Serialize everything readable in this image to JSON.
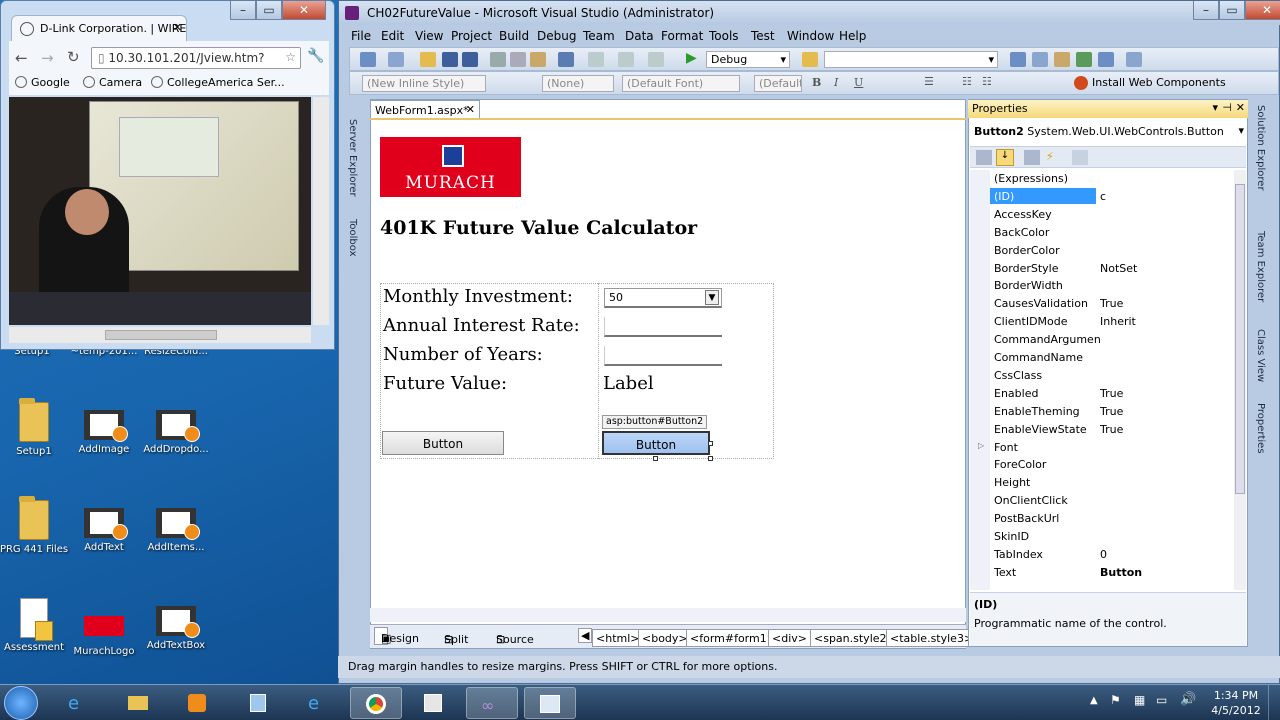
{
  "desktop": {
    "icons": [
      {
        "label": "Setup1",
        "type": "folder"
      },
      {
        "label": "~temp-201...",
        "type": "film"
      },
      {
        "label": "ResizeColu...",
        "type": "film"
      },
      {
        "label": "Setup1",
        "type": "folder"
      },
      {
        "label": "AddImage",
        "type": "film"
      },
      {
        "label": "AddDropdo...",
        "type": "film"
      },
      {
        "label": "PRG 441 Files",
        "type": "folder"
      },
      {
        "label": "AddText",
        "type": "film"
      },
      {
        "label": "AddItems...",
        "type": "film"
      },
      {
        "label": "Assessment",
        "type": "doc"
      },
      {
        "label": "MurachLogo",
        "type": "image"
      },
      {
        "label": "AddTextBox",
        "type": "film"
      }
    ]
  },
  "browser": {
    "tab_title": "D-Link Corporation. | WIREL",
    "url": "10.30.101.201/Jview.htm?",
    "bookmarks": [
      "Google",
      "Camera",
      "CollegeAmerica Ser..."
    ]
  },
  "vs": {
    "title": "CH02FutureValue - Microsoft Visual Studio (Administrator)",
    "menu": [
      "File",
      "Edit",
      "View",
      "Project",
      "Build",
      "Debug",
      "Team",
      "Data",
      "Format",
      "Tools",
      "Test",
      "Window",
      "Help"
    ],
    "config": "Debug",
    "install_label": "Install Web Components",
    "style_boxes": [
      "(New Inline Style)",
      "(None)",
      "(Default Font)",
      "(Default"
    ],
    "left_tabs": [
      "Server Explorer",
      "Toolbox"
    ],
    "right_tabs": [
      "Solution Explorer",
      "Team Explorer",
      "Class View",
      "Properties"
    ],
    "doc_tab": "WebForm1.aspx*",
    "designer": {
      "logo": "MURACH",
      "heading": "401K Future Value Calculator",
      "labels": [
        "Monthly Investment:",
        "Annual Interest Rate:",
        "Number of Years:",
        "Future Value:"
      ],
      "dropdown_value": "50",
      "future_value": "Label",
      "button_tag": "asp:button#Button2",
      "button1": "Button",
      "button2": "Button"
    },
    "bottom": {
      "views": [
        "Design",
        "Split",
        "Source"
      ],
      "breadcrumbs": [
        "<html>",
        "<body>",
        "<form#form1>",
        "<div>",
        "<span.style2>",
        "<table.style3>"
      ]
    },
    "status": "Drag margin handles to resize margins. Press SHIFT or CTRL for more options.",
    "properties": {
      "title": "Properties",
      "object_name": "Button2",
      "object_type": "System.Web.UI.WebControls.Button",
      "rows": [
        {
          "name": "(Expressions)",
          "value": ""
        },
        {
          "name": "(ID)",
          "value": "c"
        },
        {
          "name": "AccessKey",
          "value": ""
        },
        {
          "name": "BackColor",
          "value": ""
        },
        {
          "name": "BorderColor",
          "value": ""
        },
        {
          "name": "BorderStyle",
          "value": "NotSet"
        },
        {
          "name": "BorderWidth",
          "value": ""
        },
        {
          "name": "CausesValidation",
          "value": "True"
        },
        {
          "name": "ClientIDMode",
          "value": "Inherit"
        },
        {
          "name": "CommandArgumen",
          "value": ""
        },
        {
          "name": "CommandName",
          "value": ""
        },
        {
          "name": "CssClass",
          "value": ""
        },
        {
          "name": "Enabled",
          "value": "True"
        },
        {
          "name": "EnableTheming",
          "value": "True"
        },
        {
          "name": "EnableViewState",
          "value": "True"
        },
        {
          "name": "Font",
          "value": ""
        },
        {
          "name": "ForeColor",
          "value": ""
        },
        {
          "name": "Height",
          "value": ""
        },
        {
          "name": "OnClientClick",
          "value": ""
        },
        {
          "name": "PostBackUrl",
          "value": ""
        },
        {
          "name": "SkinID",
          "value": ""
        },
        {
          "name": "TabIndex",
          "value": "0"
        },
        {
          "name": "Text",
          "value": "Button"
        }
      ],
      "desc_title": "(ID)",
      "desc_text": "Programmatic name of the control."
    }
  },
  "taskbar": {
    "time": "1:34 PM",
    "date": "4/5/2012"
  }
}
